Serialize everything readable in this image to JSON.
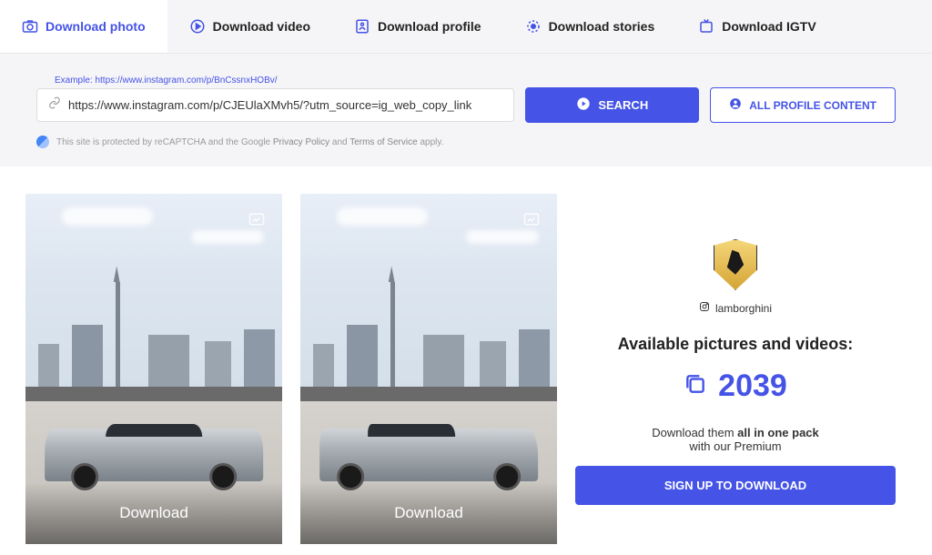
{
  "tabs": [
    {
      "label": "Download photo"
    },
    {
      "label": "Download video"
    },
    {
      "label": "Download profile"
    },
    {
      "label": "Download stories"
    },
    {
      "label": "Download IGTV"
    }
  ],
  "search": {
    "example_label": "Example: https://www.instagram.com/p/BnCssnxHOBv/",
    "input_value": "https://www.instagram.com/p/CJEUlaXMvh5/?utm_source=ig_web_copy_link",
    "search_label": "SEARCH",
    "all_profile_label": "ALL PROFILE CONTENT"
  },
  "recaptcha": {
    "prefix": "This site is protected by reCAPTCHA and the Google ",
    "privacy": "Privacy Policy",
    "and": " and ",
    "terms": "Terms of Service",
    "suffix": " apply."
  },
  "cards": [
    {
      "download_label": "Download"
    },
    {
      "download_label": "Download"
    }
  ],
  "sidebar": {
    "username": "lamborghini",
    "available_label": "Available pictures and videos:",
    "count": "2039",
    "download_prefix": "Download them ",
    "download_bold": "all in one pack",
    "download_sub": "with our Premium",
    "signup_label": "SIGN UP TO DOWNLOAD"
  }
}
